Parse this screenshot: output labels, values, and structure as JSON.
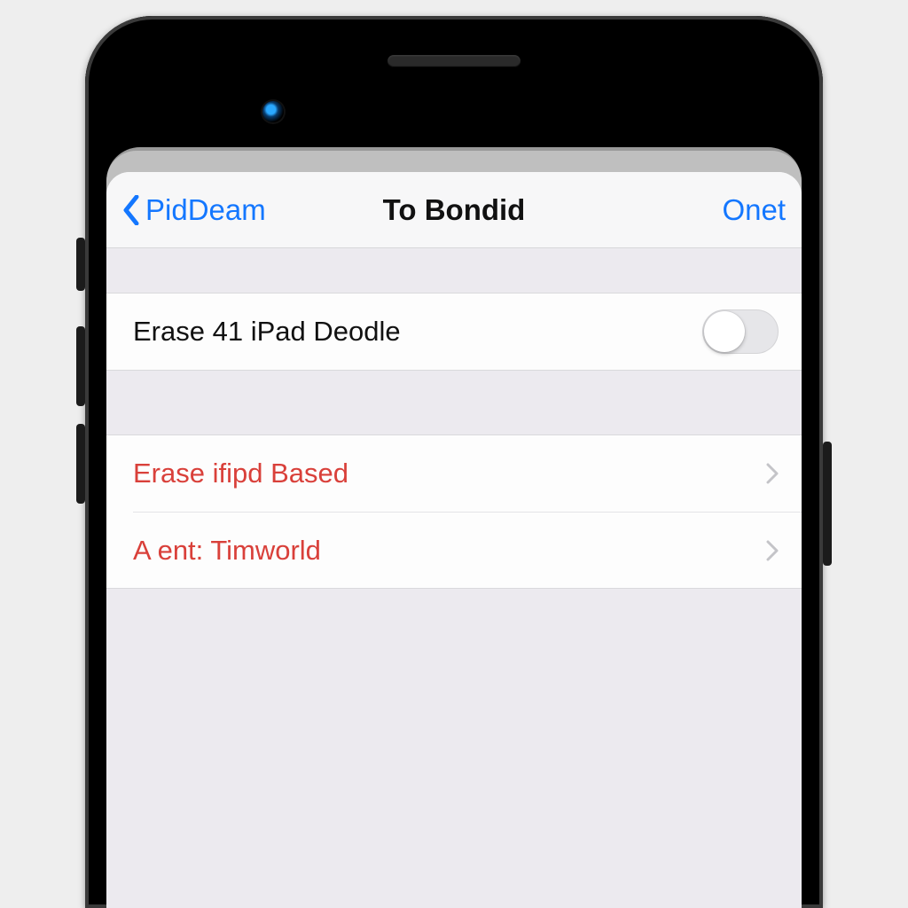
{
  "colors": {
    "accent": "#1477ff",
    "destructive": "#d9403a"
  },
  "nav": {
    "back_label": "PidDeam",
    "title": "To Bondid",
    "action_label": "Onet"
  },
  "group1": {
    "rows": [
      {
        "label": "Erase 41 iPad Deodle",
        "toggle": false
      }
    ]
  },
  "group2": {
    "rows": [
      {
        "label": "Erase ifipd Based"
      },
      {
        "label": "A ent: Timworld"
      }
    ]
  }
}
